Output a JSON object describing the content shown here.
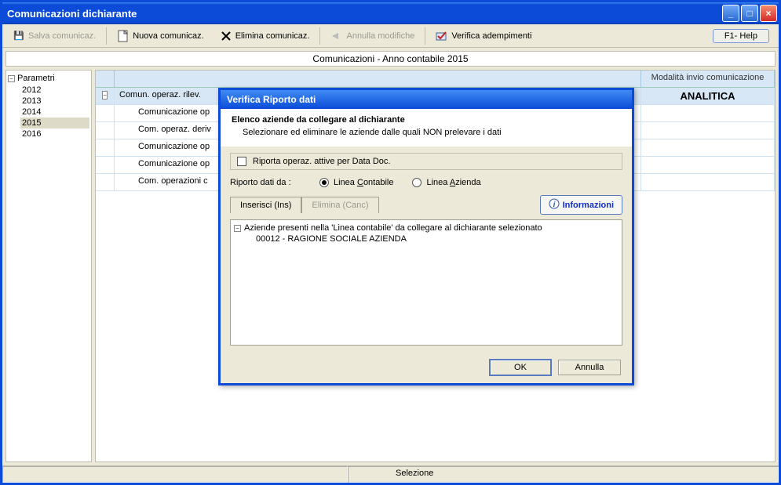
{
  "window": {
    "title": "Comunicazioni dichiarante"
  },
  "toolbar": {
    "save": "Salva comunicaz.",
    "new": "Nuova comunicaz.",
    "delete": "Elimina comunicaz.",
    "undo": "Annulla modifiche",
    "verify": "Verifica adempimenti",
    "help": "F1- Help"
  },
  "yearbar": "Comunicazioni - Anno contabile 2015",
  "tree": {
    "root": "Parametri",
    "years": [
      "2012",
      "2013",
      "2014",
      "2015",
      "2016"
    ],
    "selected": "2015"
  },
  "grid": {
    "col_mod": "Modalità invio comunicazione",
    "rows": [
      {
        "label": "Comun. operaz. rilev.",
        "mod": "ANALITICA",
        "expand": true
      },
      {
        "label": "Comunicazione op"
      },
      {
        "label": "Com. operaz. deriv"
      },
      {
        "label": "Comunicazione op"
      },
      {
        "label": "Comunicazione op"
      },
      {
        "label": "Com. operazioni c"
      }
    ]
  },
  "status": {
    "selezione": "Selezione"
  },
  "dialog": {
    "title": "Verifica Riporto dati",
    "heading": "Elenco aziende da collegare al dichiarante",
    "sub": "Selezionare ed eliminare le aziende dalle quali NON prelevare i dati",
    "checkbox": "Riporta operaz. attive per Data Doc.",
    "radio_label": "Riporto dati da :",
    "radio_contabile": "Linea Contabile",
    "radio_azienda": "Linea Azienda",
    "btn_ins": "Inserisci (Ins)",
    "btn_del": "Elimina (Canc)",
    "btn_info": "Informazioni",
    "list_root": "Aziende presenti nella 'Linea contabile' da collegare al dichiarante selezionato",
    "list_item": "00012 - RAGIONE SOCIALE AZIENDA",
    "ok": "OK",
    "cancel": "Annulla"
  }
}
